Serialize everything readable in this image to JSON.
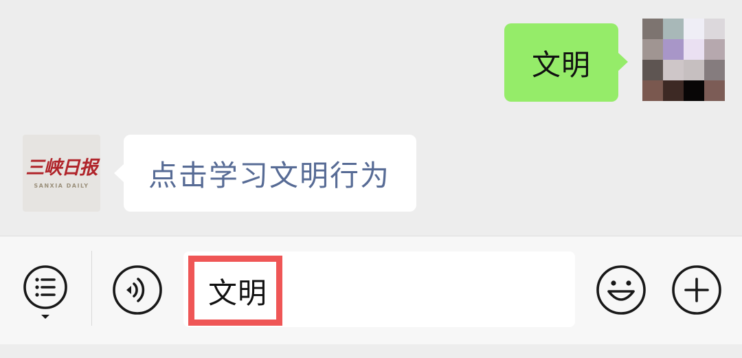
{
  "conversation": {
    "outgoing": {
      "text": "文明",
      "bubble_color": "#95ec69"
    },
    "incoming": {
      "text": "点击学习文明行为",
      "text_color": "#576b95",
      "sender_logo": {
        "name_cn": "三峡日报",
        "name_en": "SANXIA DAILY"
      }
    },
    "self_avatar_colors": [
      "#7d7470",
      "#a8b8b8",
      "#efeef6",
      "#dcd8dc",
      "#a09592",
      "#a896c8",
      "#eae0f2",
      "#b6a8ae",
      "#5e5552",
      "#cec6c8",
      "#c6bfc0",
      "#857c7e",
      "#7a584f",
      "#3d2924",
      "#080606",
      "#7c5c56"
    ]
  },
  "input_bar": {
    "value": "文明",
    "highlight_color": "#ef5656",
    "icons": {
      "menu": "menu-list-icon",
      "voice": "voice-icon",
      "emoji": "smiley-icon",
      "more": "plus-icon"
    }
  }
}
